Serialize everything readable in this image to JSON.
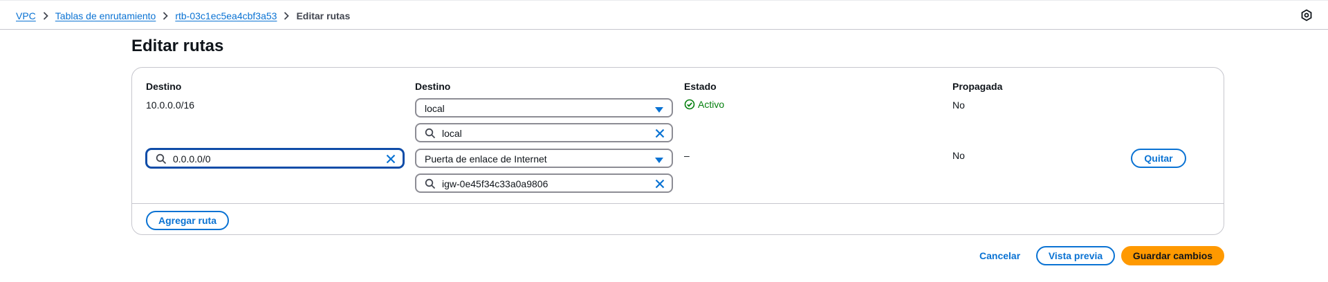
{
  "breadcrumb": {
    "items": [
      "VPC",
      "Tablas de enrutamiento",
      "rtb-03c1ec5ea4cbf3a53"
    ],
    "current": "Editar rutas"
  },
  "page": {
    "title": "Editar rutas"
  },
  "table": {
    "headers": {
      "destination": "Destino",
      "target": "Destino",
      "status": "Estado",
      "propagated": "Propagada"
    },
    "rows": [
      {
        "destination": "10.0.0.0/16",
        "target_type": "local",
        "target_value": "local",
        "status": "Activo",
        "propagated": "No"
      },
      {
        "destination_input": "0.0.0.0/0",
        "target_type": "Puerta de enlace de Internet",
        "target_value": "igw-0e45f34c33a0a9806",
        "status": "–",
        "propagated": "No",
        "remove_label": "Quitar"
      }
    ],
    "add_route_label": "Agregar ruta"
  },
  "actions": {
    "cancel": "Cancelar",
    "preview": "Vista previa",
    "save": "Guardar cambios"
  },
  "colors": {
    "link": "#0972d3",
    "success": "#037f0c",
    "primary": "#ff9900"
  },
  "icons": [
    "chevron-right-icon",
    "preferences-icon",
    "caret-down-icon",
    "search-icon",
    "clear-icon",
    "status-success-icon"
  ]
}
